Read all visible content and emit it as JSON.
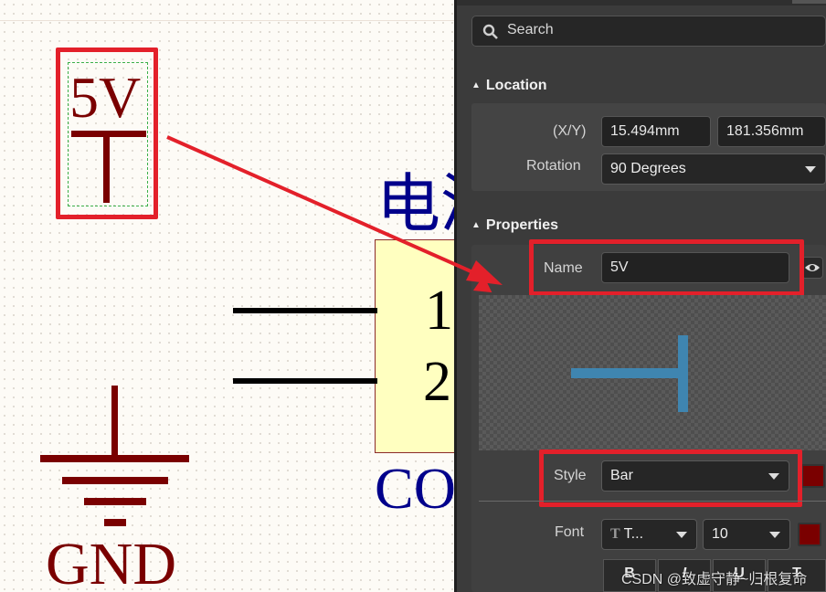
{
  "schematic": {
    "power_net_label": "5V",
    "partial_title": "电源",
    "pin_1": "1",
    "pin_2": "2",
    "partial_designator": "CO",
    "gnd_label": "GND"
  },
  "panel": {
    "search_placeholder": "Search",
    "location_header": "Location",
    "xy_label": "(X/Y)",
    "x_value": "15.494mm",
    "y_value": "181.356mm",
    "rotation_label": "Rotation",
    "rotation_value": "90 Degrees",
    "properties_header": "Properties",
    "name_label": "Name",
    "name_value": "5V",
    "style_label": "Style",
    "style_value": "Bar",
    "font_label": "Font",
    "font_value": "T...",
    "font_size": "10",
    "bold_btn": "B",
    "italic_btn": "I",
    "underline_btn": "U",
    "strike_btn": "T"
  },
  "colors": {
    "accent_red": "#e3202a",
    "net_color": "#7a0000",
    "preview_symbol": "#3f85b0"
  },
  "watermark": "CSDN @致虚守静~归根复命"
}
